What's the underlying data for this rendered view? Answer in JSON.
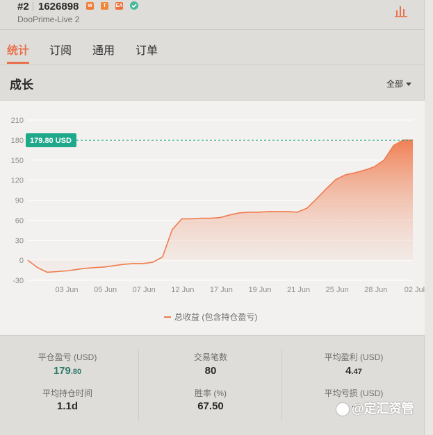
{
  "account": {
    "rank": "#2",
    "id": "1626898",
    "server": "DooPrime-Live 2",
    "badges": [
      "W",
      "T",
      "EA"
    ]
  },
  "tabs": [
    {
      "label": "统计",
      "active": true
    },
    {
      "label": "订阅",
      "active": false
    },
    {
      "label": "通用",
      "active": false
    },
    {
      "label": "订单",
      "active": false
    }
  ],
  "growth": {
    "title": "成长",
    "range_label": "全部"
  },
  "colors": {
    "accent": "#e8704a",
    "line": "#f07a4c",
    "teal": "#1fa98a"
  },
  "chart_data": {
    "type": "area",
    "ylim": [
      -30,
      210
    ],
    "yticks": [
      -30,
      0,
      30,
      60,
      90,
      120,
      150,
      180,
      210
    ],
    "xticks": [
      "03 Jun",
      "05 Jun",
      "07 Jun",
      "12 Jun",
      "17 Jun",
      "19 Jun",
      "21 Jun",
      "25 Jun",
      "28 Jun",
      "02 Jul"
    ],
    "current_label": "179.80 USD",
    "current_value": 179.8,
    "legend": "总收益 (包含持仓盈亏)",
    "grid": true,
    "series": [
      {
        "values": [
          0,
          -11,
          -18,
          -17,
          -16,
          -14,
          -12,
          -11,
          -10,
          -8,
          -6,
          -5,
          -5,
          -3,
          5,
          46,
          62,
          62,
          63,
          63,
          64,
          68,
          71,
          72,
          72,
          73,
          73,
          73,
          72,
          78,
          92,
          107,
          121,
          128,
          131,
          135,
          140,
          150,
          172,
          180,
          180
        ]
      }
    ]
  },
  "stats": [
    {
      "label": "平仓盈亏 (USD)",
      "value": "179",
      "decimals": ".80"
    },
    {
      "label": "交易笔数",
      "value": "80"
    },
    {
      "label": "平均盈利 (USD)",
      "value": "4",
      "decimals": ".47"
    },
    {
      "label": "平均持仓时间",
      "value": "1.1d"
    },
    {
      "label": "胜率 (%)",
      "value": "67.50"
    },
    {
      "label": "平均亏损 (USD)",
      "value": "-"
    }
  ],
  "watermark": "@定汇资管"
}
